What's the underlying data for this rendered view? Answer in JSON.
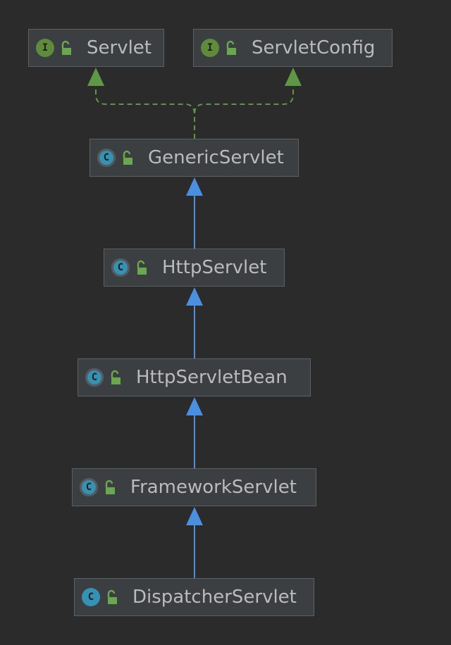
{
  "colors": {
    "background": "#2b2b2b",
    "node_fill": "#3c3f41",
    "node_border": "#5e6164",
    "text": "#bbbbbb",
    "interface_badge": "#5f8c3a",
    "class_badge": "#3592b3",
    "extends_arrow": "#4a8fe0",
    "implements_arrow": "#5e9846",
    "lock": "#6aa84f"
  },
  "nodes": [
    {
      "id": "servlet",
      "label": "Servlet",
      "kind": "interface",
      "badge": "I",
      "icon": "interface-icon",
      "visibility_icon": "unlocked-icon"
    },
    {
      "id": "servletconfig",
      "label": "ServletConfig",
      "kind": "interface",
      "badge": "I",
      "icon": "interface-icon",
      "visibility_icon": "unlocked-icon"
    },
    {
      "id": "genericservlet",
      "label": "GenericServlet",
      "kind": "abstract-class",
      "badge": "C",
      "icon": "abstract-class-icon",
      "visibility_icon": "unlocked-icon"
    },
    {
      "id": "httpservlet",
      "label": "HttpServlet",
      "kind": "abstract-class",
      "badge": "C",
      "icon": "abstract-class-icon",
      "visibility_icon": "unlocked-icon"
    },
    {
      "id": "httpservletbean",
      "label": "HttpServletBean",
      "kind": "abstract-class",
      "badge": "C",
      "icon": "abstract-class-icon",
      "visibility_icon": "unlocked-icon"
    },
    {
      "id": "frameworkservlet",
      "label": "FrameworkServlet",
      "kind": "abstract-class",
      "badge": "C",
      "icon": "abstract-class-icon",
      "visibility_icon": "unlocked-icon"
    },
    {
      "id": "dispatcherservlet",
      "label": "DispatcherServlet",
      "kind": "class",
      "badge": "C",
      "icon": "class-icon",
      "visibility_icon": "unlocked-icon"
    }
  ],
  "edges": [
    {
      "from": "genericservlet",
      "to": "servlet",
      "type": "implements"
    },
    {
      "from": "genericservlet",
      "to": "servletconfig",
      "type": "implements"
    },
    {
      "from": "httpservlet",
      "to": "genericservlet",
      "type": "extends"
    },
    {
      "from": "httpservletbean",
      "to": "httpservlet",
      "type": "extends"
    },
    {
      "from": "frameworkservlet",
      "to": "httpservletbean",
      "type": "extends"
    },
    {
      "from": "dispatcherservlet",
      "to": "frameworkservlet",
      "type": "extends"
    }
  ]
}
